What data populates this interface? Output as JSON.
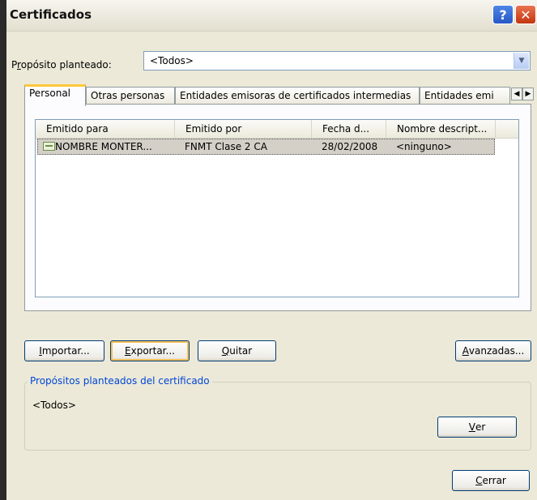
{
  "window": {
    "title": "Certificados",
    "help_label": "?",
    "close_label": "✕"
  },
  "purpose": {
    "label_prefix": "P",
    "label_access_key": "r",
    "label_rest": "opósito planteado:",
    "selected": "<Todos>"
  },
  "tabs": [
    {
      "label": "Personal",
      "active": true
    },
    {
      "label": "Otras personas",
      "active": false
    },
    {
      "label": "Entidades emisoras de certificados intermedias",
      "active": false
    },
    {
      "label": "Entidades emi",
      "active": false
    }
  ],
  "tab_scroll": {
    "left": "◀",
    "right": "▶"
  },
  "list": {
    "columns": [
      "Emitido para",
      "Emitido por",
      "Fecha d...",
      "Nombre descript..."
    ],
    "rows": [
      {
        "issued_to": "NOMBRE MONTER...",
        "issued_by": "FNMT Clase 2 CA",
        "expiry": "28/02/2008",
        "friendly_name": "<ninguno>",
        "icon": "certificate-icon",
        "selected": true
      }
    ]
  },
  "buttons": {
    "import": {
      "key": "I",
      "rest": "mportar..."
    },
    "export": {
      "key": "E",
      "rest": "xportar..."
    },
    "remove": {
      "key": "Q",
      "rest": "uitar"
    },
    "advanced": {
      "key": "A",
      "rest": "vanzadas..."
    },
    "view": {
      "key": "V",
      "rest": "er"
    },
    "close": {
      "key": "C",
      "rest": "errar"
    }
  },
  "group": {
    "title": "Propósitos planteados del certificado",
    "value": "<Todos>"
  },
  "colors": {
    "title_close": "#c2360f",
    "title_help": "#2758c6",
    "selection": "#d4d0c8",
    "tab_highlight": "#ffc83c",
    "group_title": "#0046d5"
  }
}
